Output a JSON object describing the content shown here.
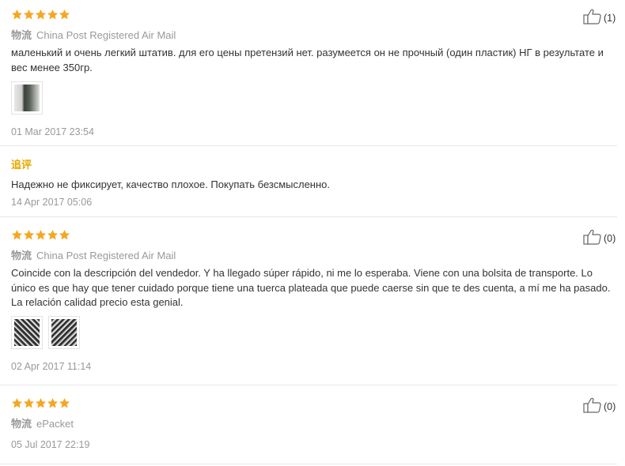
{
  "reviews": [
    {
      "rating": 5,
      "logistics_label": "物流",
      "shipping": "China Post Registered Air Mail",
      "text": "маленький и очень легкий штатив. для его цены претензий нет. разумеется он не прочный (один пластик) НГ в результате и вес менее 350гр.",
      "date": "01 Mar 2017 23:54",
      "likes": "(1)",
      "followup": {
        "label": "追评",
        "text": "Надежно не фиксирует, качество плохое. Покупать безсмысленно.",
        "date": "14 Apr 2017 05:06"
      }
    },
    {
      "rating": 5,
      "logistics_label": "物流",
      "shipping": "China Post Registered Air Mail",
      "text": "Coincide con la descripción del vendedor. Y ha llegado súper rápido, ni me lo esperaba. Viene con una bolsita de transporte. Lo único es que hay que tener cuidado porque tiene una tuerca plateada que puede caerse sin que te des cuenta, a mí me ha pasado. La relación calidad precio esta genial.",
      "date": "02 Apr 2017 11:14",
      "likes": "(0)"
    },
    {
      "rating": 5,
      "logistics_label": "物流",
      "shipping": "ePacket",
      "date": "05 Jul 2017 22:19",
      "likes": "(0)"
    }
  ],
  "colors": {
    "star": "#f5a623",
    "followup": "#e5a800",
    "muted": "#999999",
    "text": "#333333"
  }
}
